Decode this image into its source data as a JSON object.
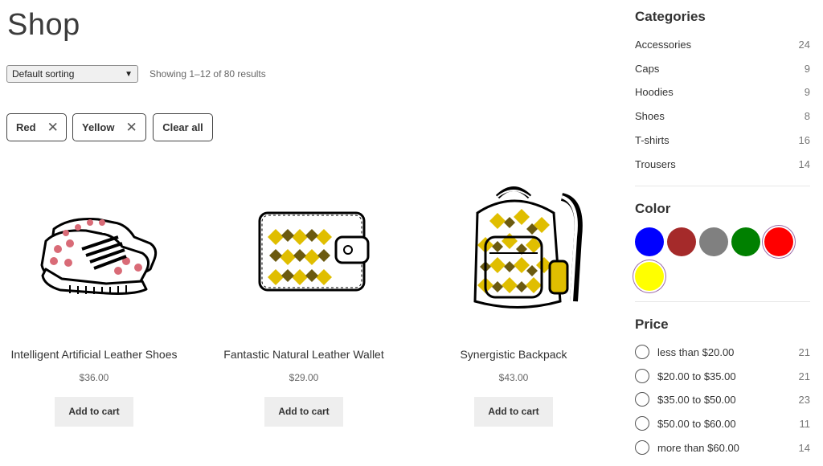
{
  "page": {
    "title": "Shop"
  },
  "toolbar": {
    "sort_selected": "Default sorting",
    "result_count": "Showing 1–12 of 80 results"
  },
  "filters": {
    "chips": [
      {
        "label": "Red"
      },
      {
        "label": "Yellow"
      }
    ],
    "clear_all": "Clear all"
  },
  "products": [
    {
      "name": "Intelligent Artificial Leather Shoes",
      "price": "$36.00",
      "button": "Add to cart"
    },
    {
      "name": "Fantastic Natural Leather Wallet",
      "price": "$29.00",
      "button": "Add to cart"
    },
    {
      "name": "Synergistic Backpack",
      "price": "$43.00",
      "button": "Add to cart"
    }
  ],
  "sidebar": {
    "categories_heading": "Categories",
    "categories": [
      {
        "label": "Accessories",
        "count": "24"
      },
      {
        "label": "Caps",
        "count": "9"
      },
      {
        "label": "Hoodies",
        "count": "9"
      },
      {
        "label": "Shoes",
        "count": "8"
      },
      {
        "label": "T-shirts",
        "count": "16"
      },
      {
        "label": "Trousers",
        "count": "14"
      }
    ],
    "color_heading": "Color",
    "colors": [
      {
        "name": "blue",
        "hex": "#0000ff",
        "selected": false
      },
      {
        "name": "brown",
        "hex": "#a52a2a",
        "selected": false
      },
      {
        "name": "gray",
        "hex": "#808080",
        "selected": false
      },
      {
        "name": "green",
        "hex": "#008000",
        "selected": false
      },
      {
        "name": "red",
        "hex": "#ff0000",
        "selected": true
      },
      {
        "name": "yellow",
        "hex": "#ffff00",
        "selected": true
      }
    ],
    "price_heading": "Price",
    "prices": [
      {
        "label": "less than $20.00",
        "count": "21"
      },
      {
        "label": "$20.00 to $35.00",
        "count": "21"
      },
      {
        "label": "$35.00 to $50.00",
        "count": "23"
      },
      {
        "label": "$50.00 to $60.00",
        "count": "11"
      },
      {
        "label": "more than $60.00",
        "count": "14"
      }
    ]
  }
}
